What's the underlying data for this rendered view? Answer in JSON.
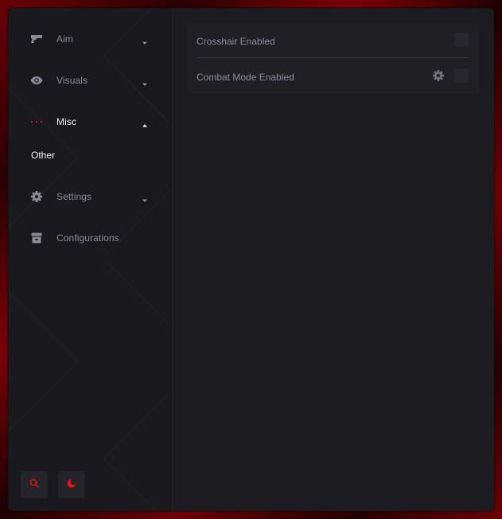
{
  "sidebar": {
    "items": [
      {
        "label": "Aim",
        "icon": "gun-icon",
        "expanded": false
      },
      {
        "label": "Visuals",
        "icon": "eye-icon",
        "expanded": false
      },
      {
        "label": "Misc",
        "icon": "dots-icon",
        "expanded": true,
        "children": [
          {
            "label": "Other"
          }
        ]
      },
      {
        "label": "Settings",
        "icon": "gear-icon",
        "expanded": false
      },
      {
        "label": "Configurations",
        "icon": "archive-icon"
      }
    ],
    "bottom_buttons": [
      {
        "icon": "search-icon"
      },
      {
        "icon": "moon-icon"
      }
    ]
  },
  "main": {
    "options": [
      {
        "label": "Crosshair Enabled",
        "enabled": false
      },
      {
        "label": "Combat Mode Enabled",
        "enabled": false,
        "has_settings": true
      }
    ]
  },
  "colors": {
    "accent": "#e0101c",
    "window_bg": "#1b1b20",
    "sidebar_bg": "#18181d",
    "panel_bg": "#1f1f24",
    "text_muted": "#8a8a9b",
    "text_active": "#f2f2f5"
  }
}
